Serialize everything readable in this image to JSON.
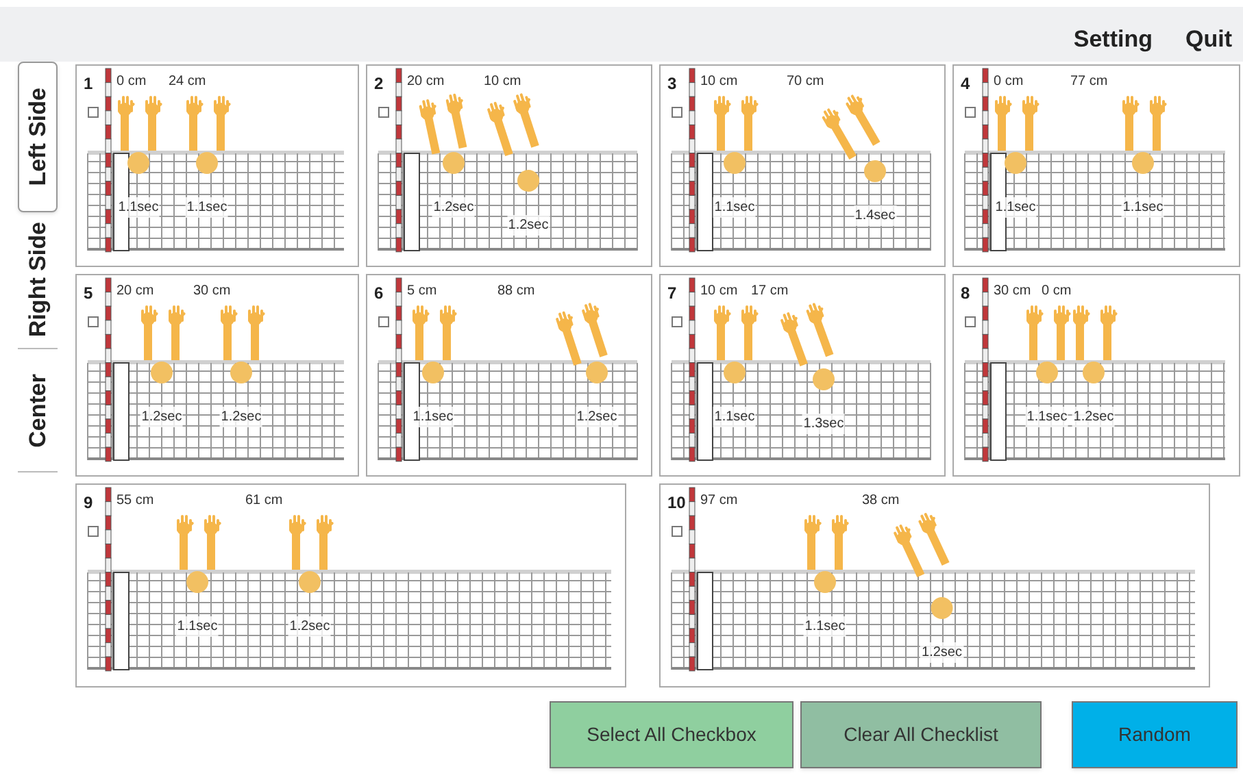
{
  "top_menu": [
    {
      "label": "Setting"
    },
    {
      "label": "Quit"
    }
  ],
  "side_tabs": [
    {
      "label": "Left Side",
      "selected": true
    },
    {
      "label": "Right Side",
      "selected": false
    },
    {
      "label": "Center",
      "selected": false
    }
  ],
  "panels": [
    {
      "number": "1",
      "checked": false,
      "distances": [
        "0 cm",
        "24 cm"
      ],
      "blocks": [
        {
          "time": "1.1sec"
        },
        {
          "time": "1.1sec"
        }
      ]
    },
    {
      "number": "2",
      "checked": false,
      "distances": [
        "20 cm",
        "10 cm"
      ],
      "blocks": [
        {
          "time": "1.2sec"
        },
        {
          "time": "1.2sec"
        }
      ]
    },
    {
      "number": "3",
      "checked": false,
      "distances": [
        "10 cm",
        "70 cm"
      ],
      "blocks": [
        {
          "time": "1.1sec"
        },
        {
          "time": "1.4sec"
        }
      ]
    },
    {
      "number": "4",
      "checked": false,
      "distances": [
        "0 cm",
        "77 cm"
      ],
      "blocks": [
        {
          "time": "1.1sec"
        },
        {
          "time": "1.1sec"
        }
      ]
    },
    {
      "number": "5",
      "checked": false,
      "distances": [
        "20 cm",
        "30 cm"
      ],
      "blocks": [
        {
          "time": "1.2sec"
        },
        {
          "time": "1.2sec"
        }
      ]
    },
    {
      "number": "6",
      "checked": false,
      "distances": [
        "5 cm",
        "88 cm"
      ],
      "blocks": [
        {
          "time": "1.1sec"
        },
        {
          "time": "1.2sec"
        }
      ]
    },
    {
      "number": "7",
      "checked": false,
      "distances": [
        "10 cm",
        "17 cm"
      ],
      "blocks": [
        {
          "time": "1.1sec"
        },
        {
          "time": "1.3sec"
        }
      ]
    },
    {
      "number": "8",
      "checked": false,
      "distances": [
        "30 cm",
        "0 cm"
      ],
      "blocks": [
        {
          "time": "1.1sec"
        },
        {
          "time": "1.2sec"
        }
      ]
    },
    {
      "number": "9",
      "checked": false,
      "distances": [
        "55 cm",
        "61 cm"
      ],
      "blocks": [
        {
          "time": "1.1sec"
        },
        {
          "time": "1.2sec"
        }
      ]
    },
    {
      "number": "10",
      "checked": false,
      "distances": [
        "97 cm",
        "38 cm"
      ],
      "blocks": [
        {
          "time": "1.1sec"
        },
        {
          "time": "1.2sec"
        }
      ]
    }
  ],
  "buttons": [
    {
      "label": "Select All Checkbox",
      "color": "#8fcf9f"
    },
    {
      "label": "Clear All Checklist",
      "color": "#90bea2"
    },
    {
      "label": "Random",
      "color": "#00b0e8"
    }
  ]
}
